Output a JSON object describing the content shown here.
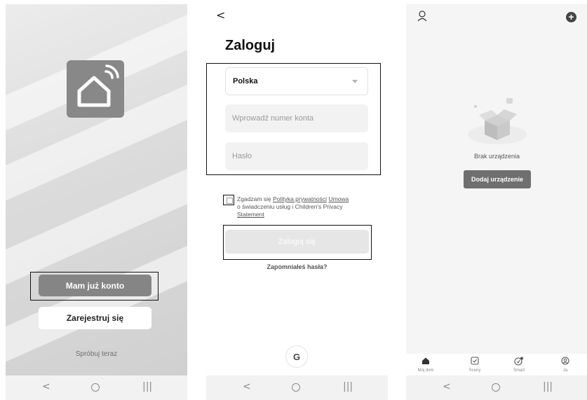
{
  "screen_welcome": {
    "have_account_label": "Mam już konto",
    "register_label": "Zarejestruj się",
    "try_now_label": "Spróbuj teraz"
  },
  "screen_login": {
    "back_glyph": "<",
    "title": "Zaloguj",
    "country_value": "Polska",
    "account_placeholder": "Wprowadź numer konta",
    "password_placeholder": "Hasło",
    "agree_prefix": "Zgadzam się",
    "privacy_link": "Polityka prywatności",
    "terms_link": "Umowa",
    "agree_middle": "o świadczeniu usług i Children's Privacy",
    "statement_link": "Statement",
    "login_label": "Zaloguj się",
    "forgot_label": "Zapomniałeś hasła?",
    "google_glyph": "G"
  },
  "screen_home": {
    "empty_label": "Brak urządzenia",
    "add_device_label": "Dodaj urządzenie",
    "add_glyph": "+",
    "tabs": [
      {
        "label": "Mój dom",
        "icon": "home-icon"
      },
      {
        "label": "Sceny",
        "icon": "scene-check-icon"
      },
      {
        "label": "Smart",
        "icon": "smart-icon"
      },
      {
        "label": "Ja",
        "icon": "profile-icon"
      }
    ]
  },
  "system_nav": {
    "back_glyph": "<",
    "recent_glyph": "|||"
  },
  "colors": {
    "primary_button": "#858585",
    "add_device_button": "#6f6f6f",
    "login_disabled": "#e6e6e6",
    "highlight_frame": "#111111"
  }
}
